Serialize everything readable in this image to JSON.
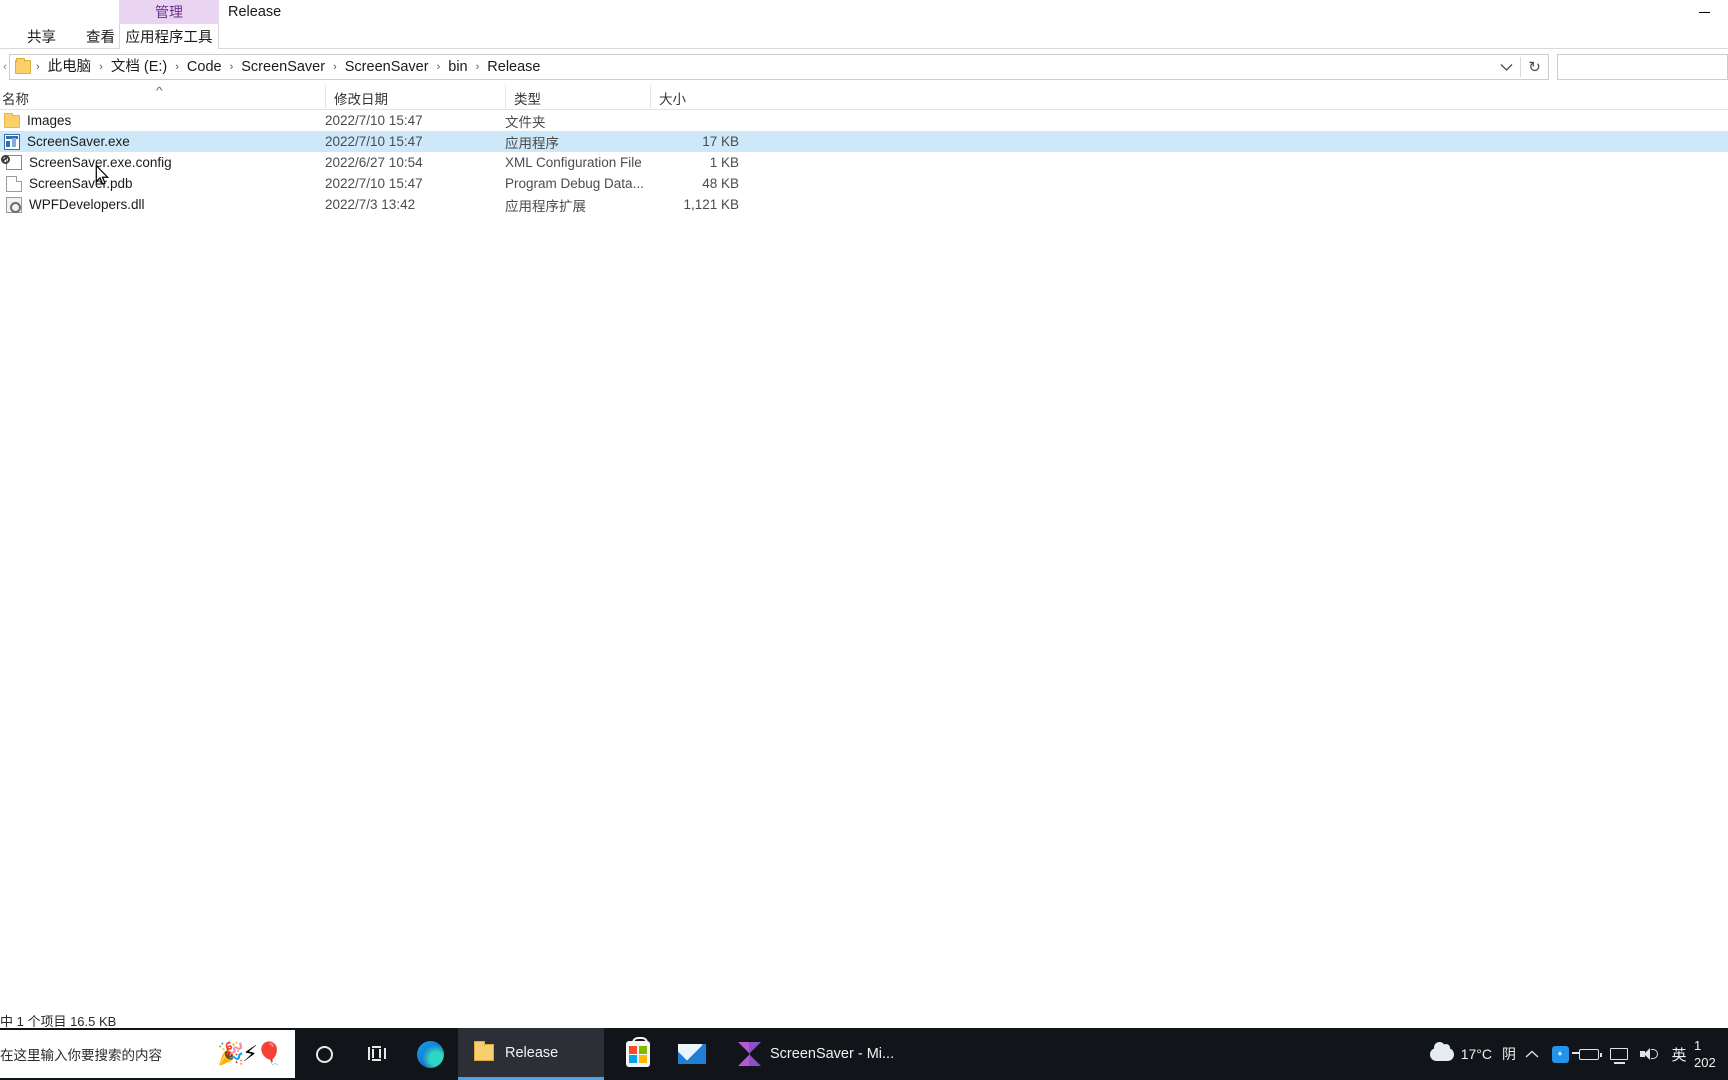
{
  "window": {
    "contextual_group_label": "管理",
    "title": "Release",
    "minimize_label": "最小化",
    "tabs": [
      {
        "label": "共享",
        "active": false
      },
      {
        "label": "查看",
        "active": false
      },
      {
        "label": "应用程序工具",
        "active": true
      }
    ]
  },
  "address_bar": {
    "back_caret": "‹",
    "crumbs": [
      "此电脑",
      "文档 (E:)",
      "Code",
      "ScreenSaver",
      "ScreenSaver",
      "bin",
      "Release"
    ],
    "separator": "›",
    "dropdown_icon": "chevron-down",
    "refresh_icon": "↻",
    "search_placeholder": ""
  },
  "columns": [
    {
      "key": "name",
      "label": "名称",
      "sort": "asc"
    },
    {
      "key": "date",
      "label": "修改日期",
      "sort": null
    },
    {
      "key": "type",
      "label": "类型",
      "sort": null
    },
    {
      "key": "size",
      "label": "大小",
      "sort": null
    }
  ],
  "sort_arrow": "^",
  "files": [
    {
      "icon": "folder",
      "name": "Images",
      "date": "2022/7/10 15:47",
      "type": "文件夹",
      "size": "",
      "selected": false
    },
    {
      "icon": "exe",
      "name": "ScreenSaver.exe",
      "date": "2022/7/10 15:47",
      "type": "应用程序",
      "size": "17 KB",
      "selected": true
    },
    {
      "icon": "config",
      "name": "ScreenSaver.exe.config",
      "date": "2022/6/27 10:54",
      "type": "XML Configuration File",
      "size": "1 KB",
      "selected": false
    },
    {
      "icon": "doc",
      "name": "ScreenSaver.pdb",
      "date": "2022/7/10 15:47",
      "type": "Program Debug Data...",
      "size": "48 KB",
      "selected": false
    },
    {
      "icon": "dll",
      "name": "WPFDevelopers.dll",
      "date": "2022/7/3 13:42",
      "type": "应用程序扩展",
      "size": "1,121 KB",
      "selected": false
    }
  ],
  "status_bar": {
    "text": "中 1 个项目  16.5 KB"
  },
  "taskbar": {
    "search_placeholder": "在这里输入你要搜索的内容",
    "search_art": "🎉⚡🎈",
    "cortana_label": "Cortana",
    "taskview_label": "任务视图",
    "edge_label": "Microsoft Edge",
    "release_label": "Release",
    "store_label": "Microsoft Store",
    "mail_label": "邮件",
    "vs_label": "ScreenSaver - Mi...",
    "tray": {
      "temperature": "17°C",
      "condition": "阴",
      "chevron": "⌃",
      "bluetooth_glyph": "᛭",
      "ime": "英",
      "clock_time": "1",
      "clock_date": "202"
    }
  },
  "colors": {
    "selection": "#cde8f9",
    "contextual_tab": "#e9d5f2",
    "taskbar_bg": "#111418",
    "active_task_underline": "#4aa3e8"
  }
}
